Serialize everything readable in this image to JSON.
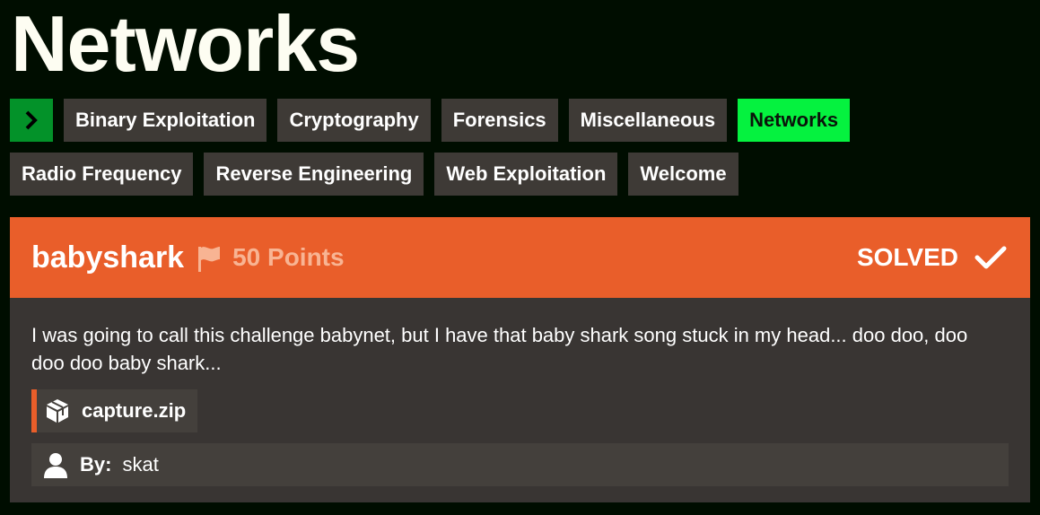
{
  "page": {
    "title": "Networks"
  },
  "categories": {
    "toggle_icon": "chevron-right-icon",
    "row1": [
      {
        "label": "Binary Exploitation",
        "active": false
      },
      {
        "label": "Cryptography",
        "active": false
      },
      {
        "label": "Forensics",
        "active": false
      },
      {
        "label": "Miscellaneous",
        "active": false
      },
      {
        "label": "Networks",
        "active": true
      }
    ],
    "row2": [
      {
        "label": "Radio Frequency",
        "active": false
      },
      {
        "label": "Reverse Engineering",
        "active": false
      },
      {
        "label": "Web Exploitation",
        "active": false
      },
      {
        "label": "Welcome",
        "active": false
      }
    ]
  },
  "challenge": {
    "name": "babyshark",
    "points": "50 Points",
    "status": "SOLVED",
    "description": "I was going to call this challenge babynet, but I have that baby shark song stuck in my head... doo doo, doo doo doo baby shark...",
    "attachment": {
      "filename": "capture.zip",
      "icon": "package-icon"
    },
    "author": {
      "label": "By:",
      "name": "skat",
      "icon": "user-icon"
    }
  },
  "colors": {
    "background": "#000d00",
    "accent": "#e95e2a",
    "active_category": "#05f23f",
    "toggle": "#039229",
    "tile": "#3e3a36"
  }
}
